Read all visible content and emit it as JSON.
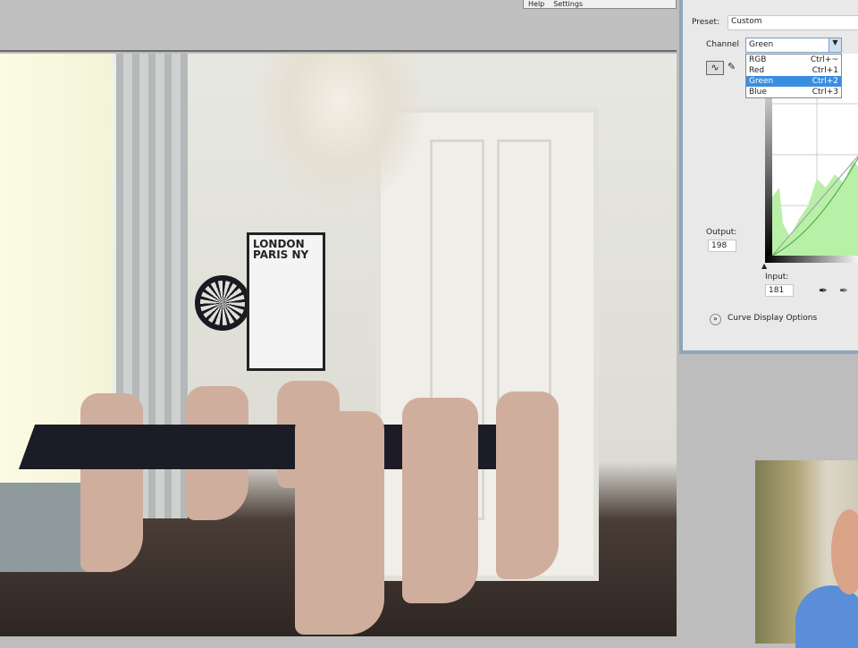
{
  "toolbar": {
    "help": "Help",
    "settings": "Settings"
  },
  "photo": {
    "poster_text": "LONDON PARIS NY"
  },
  "curves": {
    "preset_label": "Preset:",
    "preset_value": "Custom",
    "channel_label": "Channel",
    "channel_value": "Green",
    "channel_options": [
      {
        "label": "RGB",
        "shortcut": "Ctrl+~"
      },
      {
        "label": "Red",
        "shortcut": "Ctrl+1"
      },
      {
        "label": "Green",
        "shortcut": "Ctrl+2"
      },
      {
        "label": "Blue",
        "shortcut": "Ctrl+3"
      }
    ],
    "output_label": "Output:",
    "output_value": "198",
    "input_label": "Input:",
    "input_value": "181",
    "display_options": "Curve Display Options",
    "histogram_color": "#b8f0a8",
    "curve_color": "#3aa040"
  }
}
